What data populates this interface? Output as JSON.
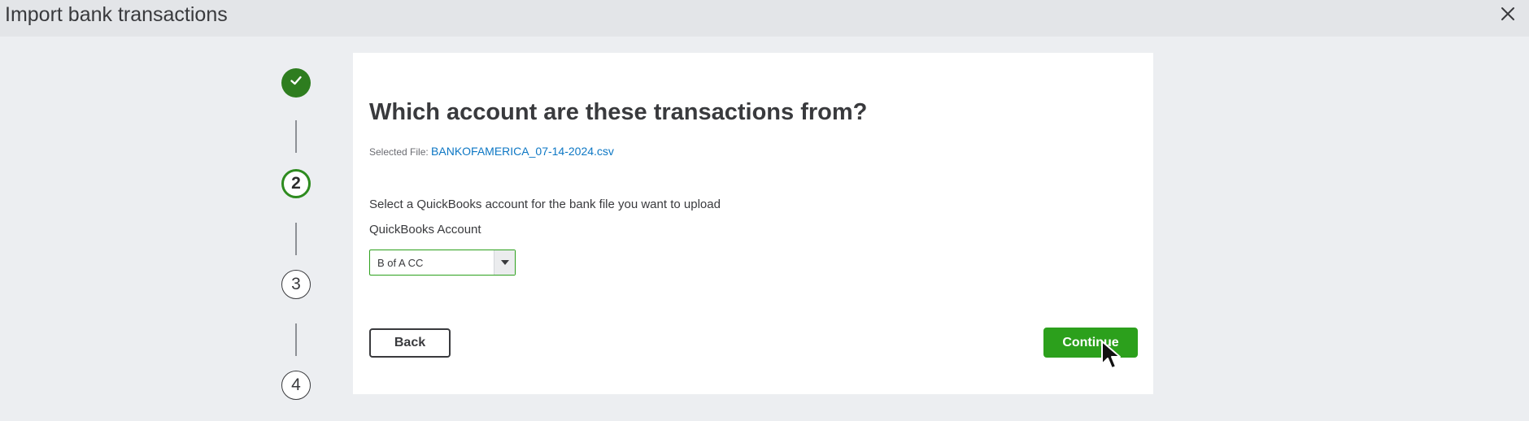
{
  "window": {
    "title": "Import bank transactions"
  },
  "stepper": {
    "steps": [
      {
        "label": "",
        "state": "done"
      },
      {
        "label": "2",
        "state": "current"
      },
      {
        "label": "3",
        "state": "pending"
      },
      {
        "label": "4",
        "state": "pending"
      }
    ]
  },
  "main": {
    "heading": "Which account are these transactions from?",
    "selected_file_label": "Selected File:",
    "selected_file_name": "BANKOFAMERICA_07-14-2024.csv",
    "instruction": "Select a QuickBooks account for the bank file you want to upload",
    "account_label": "QuickBooks Account",
    "account_value": "B of A CC"
  },
  "buttons": {
    "back": "Back",
    "continue": "Continue"
  },
  "colors": {
    "accent": "#2ca01c",
    "done_step": "#2e7d1f",
    "link": "#0d77c4"
  },
  "icons": [
    "close-icon",
    "checkmark-icon",
    "dropdown-arrow-icon",
    "mouse-cursor-icon"
  ]
}
